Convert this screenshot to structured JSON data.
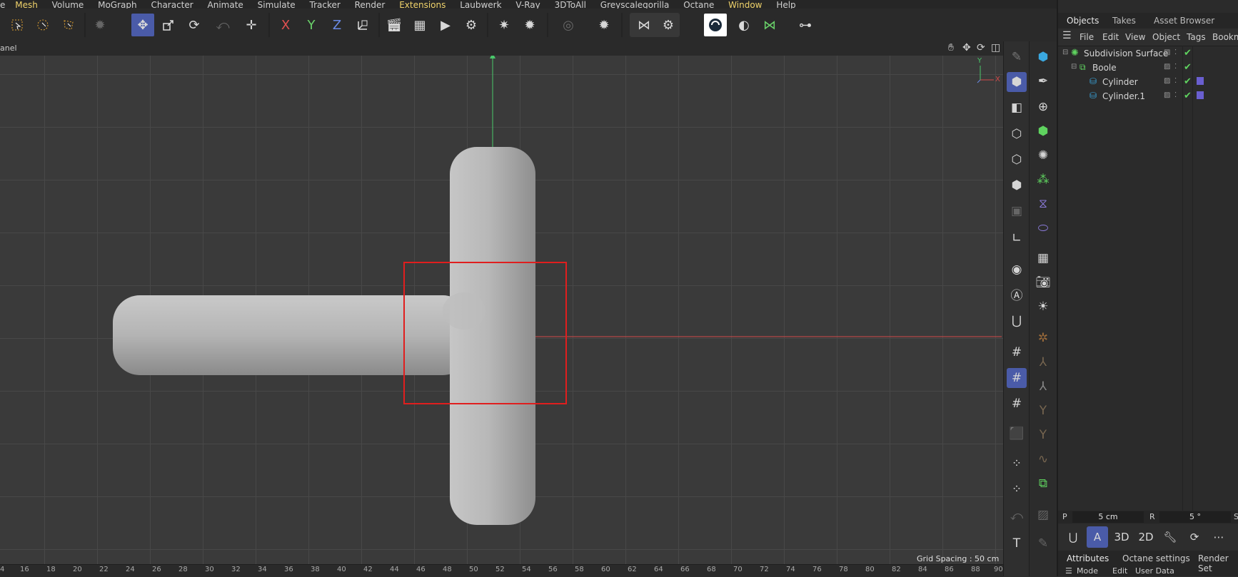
{
  "menu": [
    "Mesh",
    "Volume",
    "MoGraph",
    "Character",
    "Animate",
    "Simulate",
    "Tracker",
    "Render",
    "Extensions",
    "Laubwerk",
    "V-Ray",
    "3DToAll",
    "Greyscalegorilla",
    "Octane",
    "Window",
    "Help"
  ],
  "menu_highlight": [
    "Mesh",
    "Extensions",
    "Window"
  ],
  "menu_partial_first": "e",
  "toolbar": {
    "x_label": "X",
    "y_label": "Y",
    "z_label": "Z"
  },
  "viewport": {
    "panel_label": "anel",
    "grid_spacing": "Grid Spacing : 50 cm",
    "axis_y": "Y",
    "axis_x": "X",
    "ruler": [
      "4",
      "16",
      "18",
      "20",
      "22",
      "24",
      "26",
      "28",
      "30",
      "32",
      "34",
      "36",
      "38",
      "40",
      "42",
      "44",
      "46",
      "48",
      "50",
      "52",
      "54",
      "56",
      "58",
      "60",
      "62",
      "64",
      "66",
      "68",
      "70",
      "72",
      "74",
      "76",
      "78",
      "80",
      "82",
      "84",
      "86",
      "88",
      "90"
    ]
  },
  "panel": {
    "tabs": [
      "Objects",
      "Takes",
      "Asset Browser"
    ],
    "menu": [
      "File",
      "Edit",
      "View",
      "Object",
      "Tags",
      "Bookm"
    ],
    "objects": [
      {
        "name": "Subdivision Surface"
      },
      {
        "name": "Boole"
      },
      {
        "name": "Cylinder"
      },
      {
        "name": "Cylinder.1"
      }
    ],
    "coords": {
      "p_label": "P",
      "p_value": "5 cm",
      "r_label": "R",
      "r_value": "5 °",
      "s_label": "S"
    },
    "modebar": {
      "label_3d": "3D",
      "label_2d": "2D",
      "label_a": "A"
    },
    "attr_tabs": [
      "Attributes",
      "Octane settings",
      "Render Set"
    ],
    "attr_menu": [
      "Mode",
      "Edit",
      "User Data"
    ]
  },
  "colors": {
    "accent": "#4a5ba8",
    "selection_box": "#e01e1e",
    "axis_x": "#d24a4a",
    "axis_y": "#49c86a",
    "check": "#5fd35f"
  }
}
